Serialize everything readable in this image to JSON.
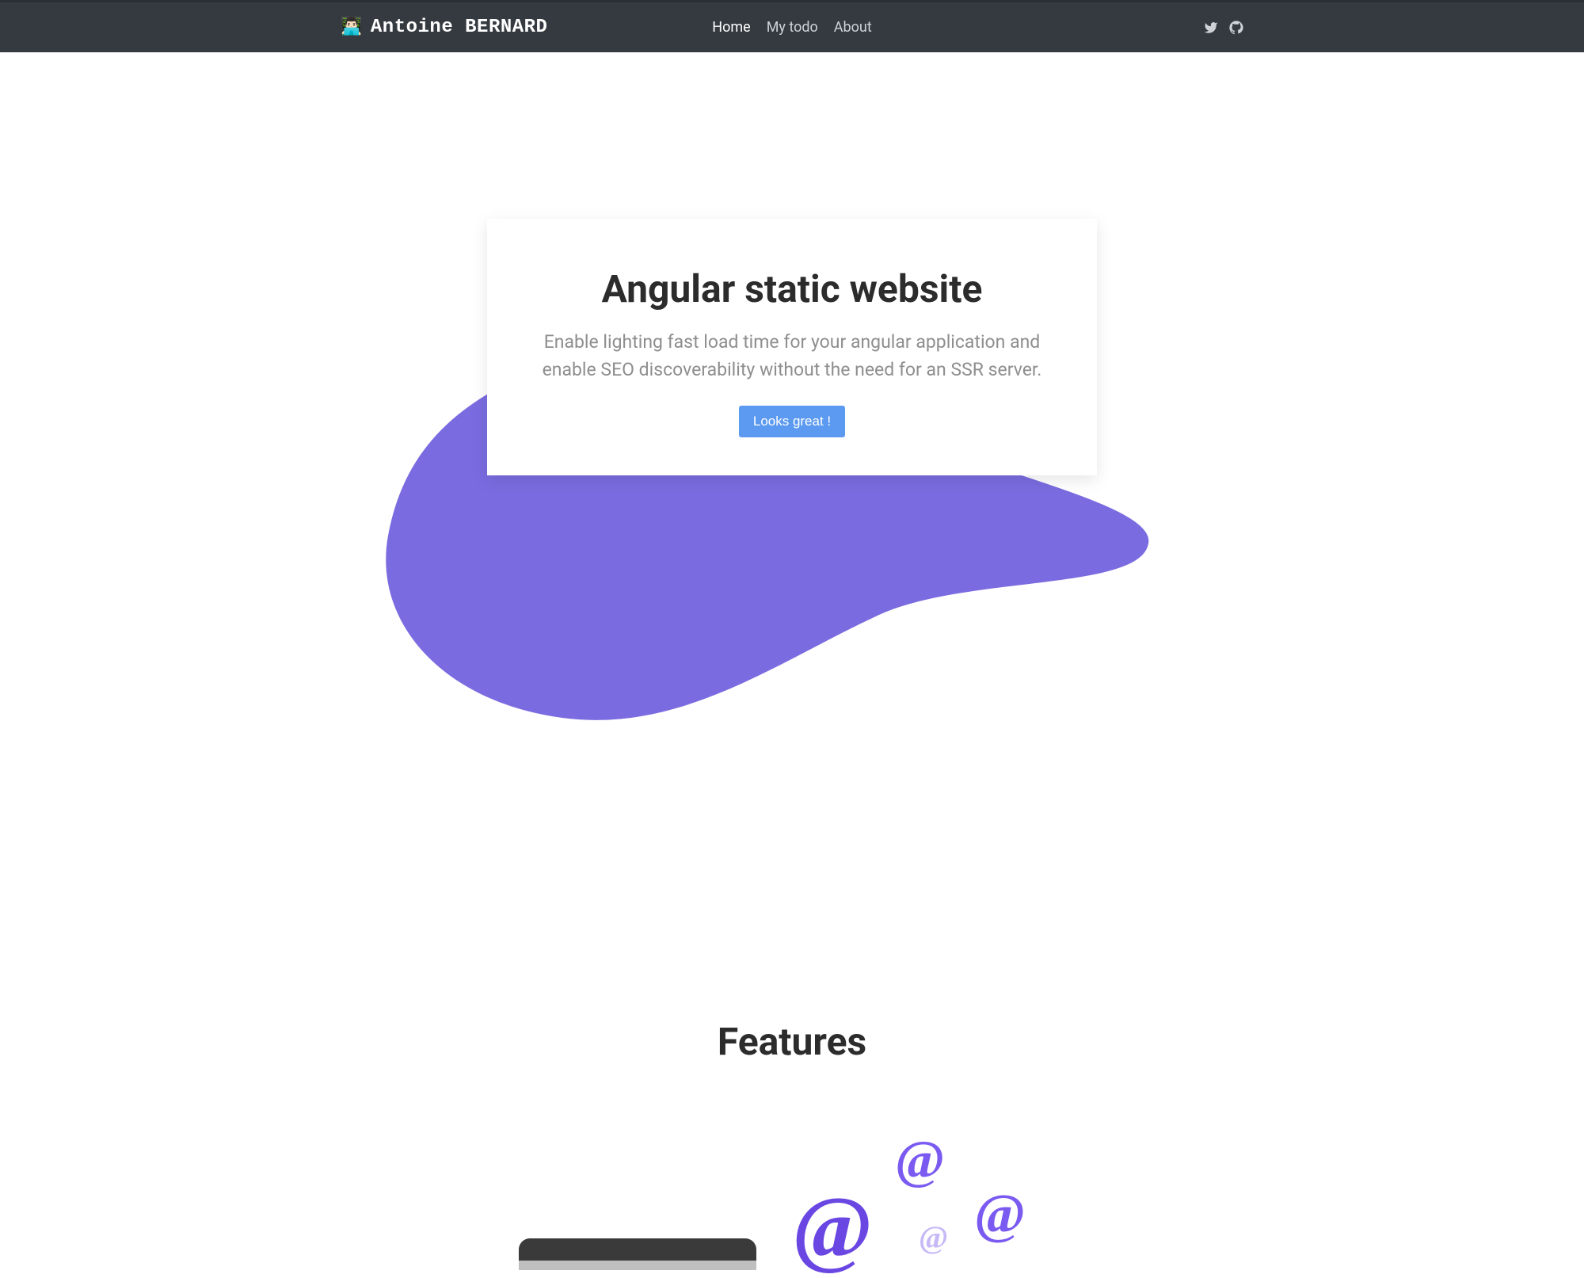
{
  "brand": {
    "emoji": "👨🏻‍💻",
    "first": "Antoine",
    "last": "BERNARD"
  },
  "nav": {
    "links": [
      {
        "label": "Home",
        "active": true
      },
      {
        "label": "My todo",
        "active": false
      },
      {
        "label": "About",
        "active": false
      }
    ]
  },
  "hero": {
    "title": "Angular static website",
    "subtitle": "Enable lighting fast load time for your angular application and enable SEO discoverability without the need for an SSR server.",
    "cta": "Looks great !"
  },
  "features": {
    "title": "Features"
  },
  "colors": {
    "navbar": "#343a40",
    "accent_primary": "#5b9af0",
    "blob": "#7a6ce0",
    "at_dark": "#6a47e3",
    "at_light": "#c7b9f6"
  }
}
